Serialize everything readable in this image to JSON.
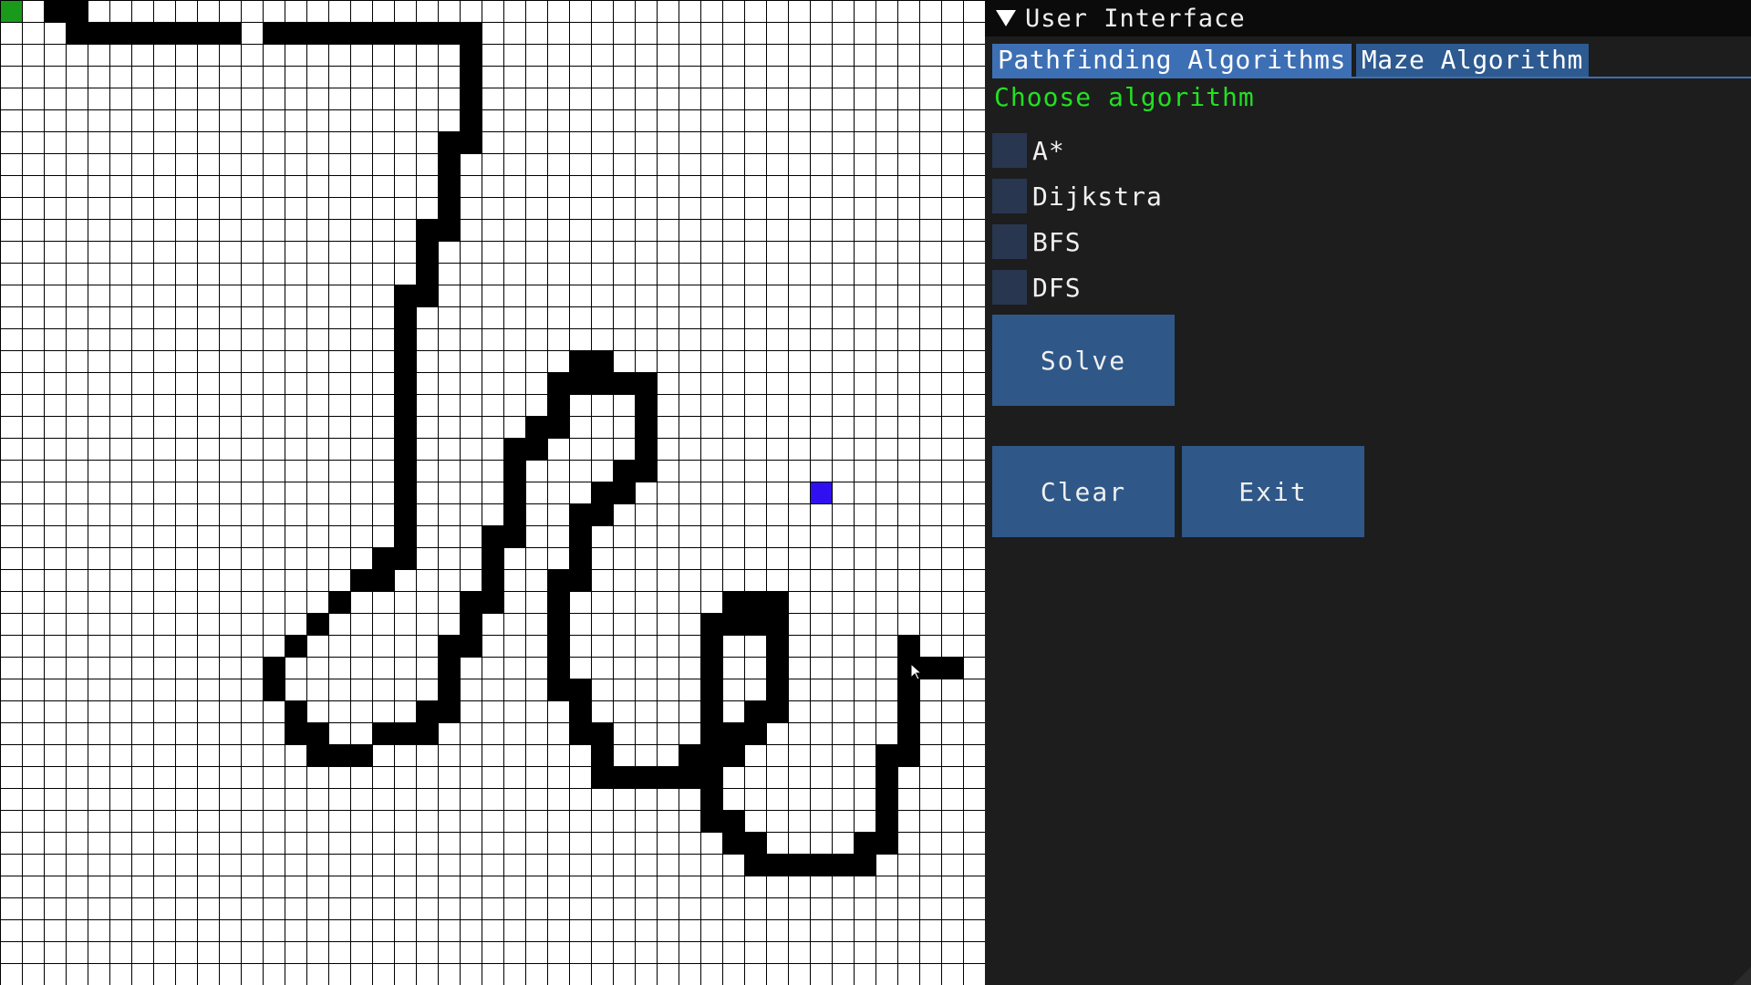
{
  "window": {
    "title": "User Interface"
  },
  "tabs": [
    {
      "label": "Pathfinding Algorithms",
      "active": true
    },
    {
      "label": "Maze Algorithm",
      "active": false
    }
  ],
  "section_label": "Choose algorithm",
  "algorithms": [
    {
      "label": "A*",
      "checked": false
    },
    {
      "label": "Dijkstra",
      "checked": false
    },
    {
      "label": "BFS",
      "checked": false
    },
    {
      "label": "DFS",
      "checked": false
    }
  ],
  "buttons": {
    "solve": "Solve",
    "clear": "Clear",
    "exit": "Exit"
  },
  "grid": {
    "columns": 45,
    "rows": 45,
    "start_cell": [
      0,
      0
    ],
    "end_cell": [
      37,
      22
    ],
    "colors": {
      "background": "#ffffff",
      "gridline": "#000000",
      "wall": "#000000",
      "start": "#1a9a1a",
      "end": "#3010f0"
    },
    "walls": [
      [
        2,
        0
      ],
      [
        3,
        0
      ],
      [
        3,
        1
      ],
      [
        4,
        1
      ],
      [
        5,
        1
      ],
      [
        6,
        1
      ],
      [
        7,
        1
      ],
      [
        8,
        1
      ],
      [
        9,
        1
      ],
      [
        10,
        1
      ],
      [
        12,
        1
      ],
      [
        13,
        1
      ],
      [
        14,
        1
      ],
      [
        15,
        1
      ],
      [
        16,
        1
      ],
      [
        17,
        1
      ],
      [
        18,
        1
      ],
      [
        19,
        1
      ],
      [
        20,
        1
      ],
      [
        21,
        1
      ],
      [
        21,
        2
      ],
      [
        21,
        3
      ],
      [
        21,
        4
      ],
      [
        21,
        5
      ],
      [
        21,
        6
      ],
      [
        20,
        6
      ],
      [
        20,
        7
      ],
      [
        20,
        8
      ],
      [
        20,
        9
      ],
      [
        20,
        10
      ],
      [
        19,
        10
      ],
      [
        19,
        11
      ],
      [
        19,
        12
      ],
      [
        19,
        13
      ],
      [
        18,
        13
      ],
      [
        18,
        14
      ],
      [
        18,
        15
      ],
      [
        18,
        16
      ],
      [
        18,
        17
      ],
      [
        18,
        18
      ],
      [
        18,
        19
      ],
      [
        18,
        20
      ],
      [
        18,
        21
      ],
      [
        18,
        22
      ],
      [
        18,
        23
      ],
      [
        18,
        24
      ],
      [
        18,
        25
      ],
      [
        17,
        25
      ],
      [
        16,
        26
      ],
      [
        17,
        26
      ],
      [
        15,
        27
      ],
      [
        14,
        28
      ],
      [
        13,
        29
      ],
      [
        12,
        30
      ],
      [
        12,
        31
      ],
      [
        13,
        32
      ],
      [
        13,
        33
      ],
      [
        14,
        33
      ],
      [
        14,
        34
      ],
      [
        15,
        34
      ],
      [
        16,
        34
      ],
      [
        17,
        33
      ],
      [
        18,
        33
      ],
      [
        19,
        33
      ],
      [
        19,
        32
      ],
      [
        20,
        32
      ],
      [
        20,
        31
      ],
      [
        20,
        30
      ],
      [
        20,
        29
      ],
      [
        21,
        29
      ],
      [
        21,
        28
      ],
      [
        21,
        27
      ],
      [
        22,
        27
      ],
      [
        22,
        26
      ],
      [
        22,
        25
      ],
      [
        22,
        24
      ],
      [
        23,
        24
      ],
      [
        23,
        23
      ],
      [
        23,
        22
      ],
      [
        23,
        21
      ],
      [
        23,
        20
      ],
      [
        24,
        20
      ],
      [
        24,
        19
      ],
      [
        25,
        19
      ],
      [
        25,
        18
      ],
      [
        25,
        17
      ],
      [
        26,
        17
      ],
      [
        27,
        17
      ],
      [
        26,
        16
      ],
      [
        27,
        16
      ],
      [
        28,
        17
      ],
      [
        29,
        17
      ],
      [
        29,
        18
      ],
      [
        29,
        19
      ],
      [
        29,
        20
      ],
      [
        29,
        21
      ],
      [
        28,
        21
      ],
      [
        28,
        22
      ],
      [
        27,
        22
      ],
      [
        27,
        23
      ],
      [
        26,
        23
      ],
      [
        26,
        24
      ],
      [
        26,
        25
      ],
      [
        26,
        26
      ],
      [
        25,
        26
      ],
      [
        25,
        27
      ],
      [
        25,
        28
      ],
      [
        25,
        29
      ],
      [
        25,
        30
      ],
      [
        25,
        31
      ],
      [
        26,
        31
      ],
      [
        26,
        32
      ],
      [
        26,
        33
      ],
      [
        27,
        33
      ],
      [
        27,
        34
      ],
      [
        27,
        35
      ],
      [
        28,
        35
      ],
      [
        29,
        35
      ],
      [
        30,
        35
      ],
      [
        31,
        35
      ],
      [
        31,
        34
      ],
      [
        32,
        34
      ],
      [
        32,
        33
      ],
      [
        32,
        32
      ],
      [
        32,
        31
      ],
      [
        32,
        30
      ],
      [
        32,
        29
      ],
      [
        32,
        28
      ],
      [
        33,
        28
      ],
      [
        34,
        28
      ],
      [
        33,
        27
      ],
      [
        34,
        27
      ],
      [
        35,
        27
      ],
      [
        35,
        28
      ],
      [
        35,
        29
      ],
      [
        35,
        30
      ],
      [
        35,
        31
      ],
      [
        35,
        32
      ],
      [
        34,
        32
      ],
      [
        34,
        33
      ],
      [
        33,
        33
      ],
      [
        33,
        34
      ],
      [
        32,
        35
      ],
      [
        32,
        36
      ],
      [
        32,
        37
      ],
      [
        33,
        37
      ],
      [
        33,
        38
      ],
      [
        34,
        38
      ],
      [
        34,
        39
      ],
      [
        35,
        39
      ],
      [
        36,
        39
      ],
      [
        37,
        39
      ],
      [
        38,
        39
      ],
      [
        39,
        39
      ],
      [
        39,
        38
      ],
      [
        40,
        38
      ],
      [
        40,
        37
      ],
      [
        40,
        36
      ],
      [
        40,
        35
      ],
      [
        40,
        34
      ],
      [
        41,
        34
      ],
      [
        41,
        33
      ],
      [
        41,
        32
      ],
      [
        41,
        31
      ],
      [
        41,
        30
      ],
      [
        42,
        30
      ],
      [
        43,
        30
      ],
      [
        41,
        29
      ]
    ]
  }
}
